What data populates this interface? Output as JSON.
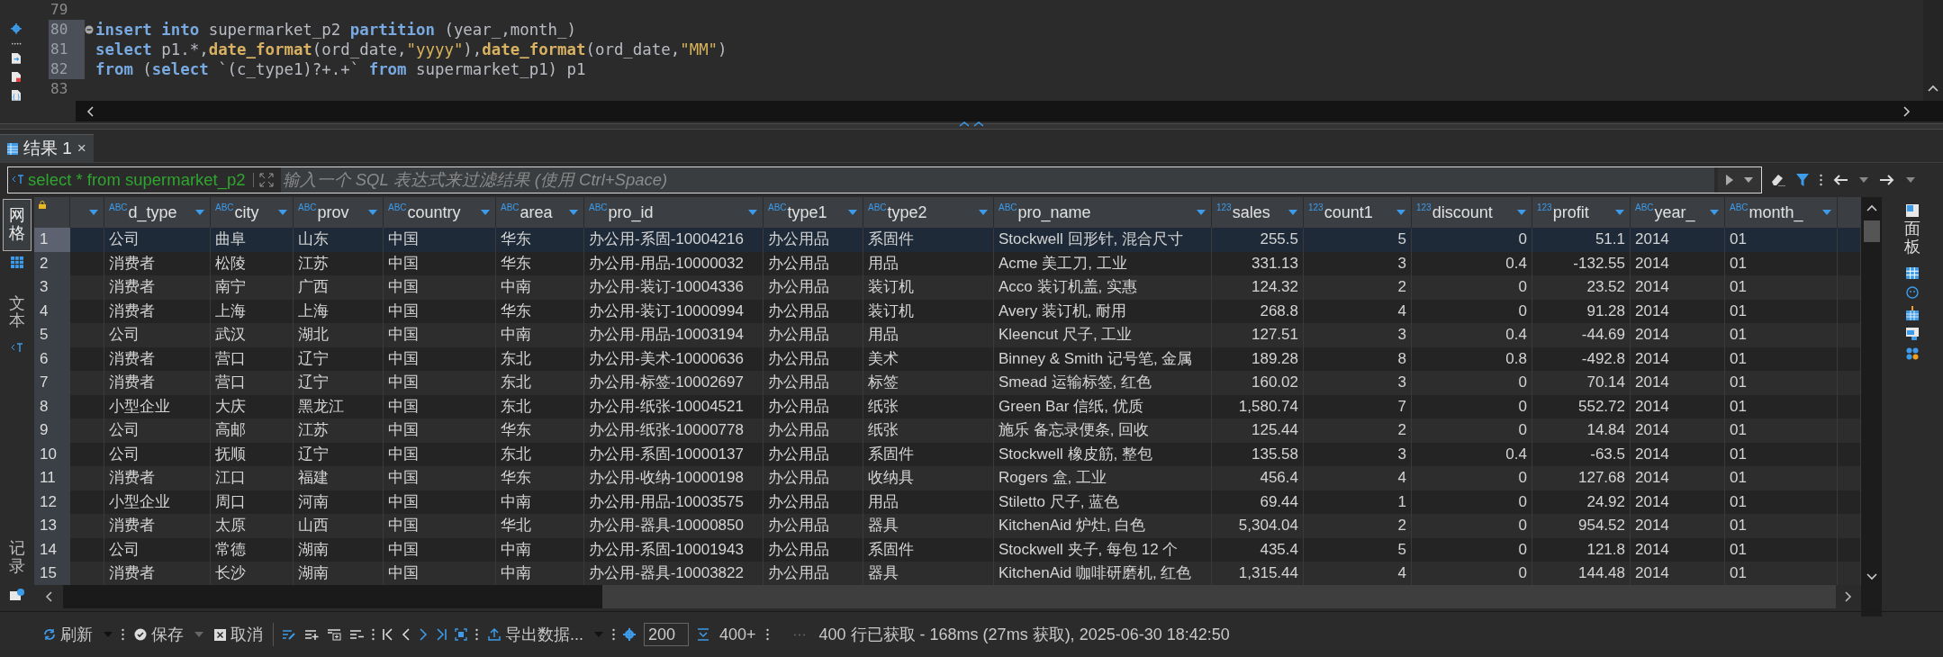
{
  "editor": {
    "lines": [
      {
        "number": "79",
        "selected": false,
        "fold_marker": false
      },
      {
        "number": "80",
        "selected": true,
        "fold_marker": true,
        "tokens": [
          {
            "text": "insert",
            "kind": "keyword"
          },
          {
            "text": " into",
            "kind": "keyword"
          },
          {
            "text": " supermarket_p2 ",
            "kind": "plain"
          },
          {
            "text": "partition",
            "kind": "keyword"
          },
          {
            "text": " (year_,month_)",
            "kind": "plain"
          }
        ]
      },
      {
        "number": "81",
        "selected": true,
        "fold_marker": false,
        "tokens": [
          {
            "text": "select",
            "kind": "keyword"
          },
          {
            "text": " p1.*,",
            "kind": "plain"
          },
          {
            "text": "date_format",
            "kind": "function"
          },
          {
            "text": "(ord_date,",
            "kind": "plain"
          },
          {
            "text": "\"yyyy\"",
            "kind": "string"
          },
          {
            "text": "),",
            "kind": "plain"
          },
          {
            "text": "date_format",
            "kind": "function"
          },
          {
            "text": "(ord_date,",
            "kind": "plain"
          },
          {
            "text": "\"MM\"",
            "kind": "string"
          },
          {
            "text": ")",
            "kind": "plain"
          }
        ]
      },
      {
        "number": "82",
        "selected": true,
        "fold_marker": false,
        "tokens": [
          {
            "text": "from",
            "kind": "keyword"
          },
          {
            "text": " (",
            "kind": "plain"
          },
          {
            "text": "select",
            "kind": "keyword"
          },
          {
            "text": " `(c_type1)?+.+` ",
            "kind": "plain"
          },
          {
            "text": "from",
            "kind": "keyword"
          },
          {
            "text": " supermarket_p1) p1",
            "kind": "plain"
          }
        ]
      },
      {
        "number": "83",
        "selected": false,
        "fold_marker": false
      }
    ]
  },
  "result_tabs": [
    {
      "label": "结果 1",
      "close": "×",
      "selected": true
    }
  ],
  "filter": {
    "query": "select * from supermarket_p2",
    "placeholder": "输入一个 SQL 表达式来过滤结果 (使用 Ctrl+Space)"
  },
  "view_tabs": [
    {
      "label": "网格",
      "selected": true
    },
    {
      "label": "文本",
      "selected": false
    },
    {
      "label": "记录",
      "selected": false
    }
  ],
  "side_panel": {
    "label": "面板"
  },
  "table": {
    "columns": [
      {
        "name": "d_type",
        "type_label": "ABC",
        "kind": "text"
      },
      {
        "name": "city",
        "type_label": "ABC",
        "kind": "text"
      },
      {
        "name": "prov",
        "type_label": "ABC",
        "kind": "text"
      },
      {
        "name": "country",
        "type_label": "ABC",
        "kind": "text"
      },
      {
        "name": "area",
        "type_label": "ABC",
        "kind": "text"
      },
      {
        "name": "pro_id",
        "type_label": "ABC",
        "kind": "text"
      },
      {
        "name": "type1",
        "type_label": "ABC",
        "kind": "text"
      },
      {
        "name": "type2",
        "type_label": "ABC",
        "kind": "text"
      },
      {
        "name": "pro_name",
        "type_label": "ABC",
        "kind": "text"
      },
      {
        "name": "sales",
        "type_label": "123",
        "kind": "number"
      },
      {
        "name": "count1",
        "type_label": "123",
        "kind": "number"
      },
      {
        "name": "discount",
        "type_label": "123",
        "kind": "number"
      },
      {
        "name": "profit",
        "type_label": "123",
        "kind": "number"
      },
      {
        "name": "year_",
        "type_label": "ABC",
        "kind": "text"
      },
      {
        "name": "month_",
        "type_label": "ABC",
        "kind": "text"
      }
    ],
    "rows": [
      {
        "number": "1",
        "selected": true,
        "cells": [
          "公司",
          "曲阜",
          "山东",
          "中国",
          "华东",
          "办公用-系固-10004216",
          "办公用品",
          "系固件",
          "Stockwell 回形针, 混合尺寸",
          "255.5",
          "5",
          "0",
          "51.1",
          "2014",
          "01"
        ]
      },
      {
        "number": "2",
        "selected": false,
        "cells": [
          "消费者",
          "松陵",
          "江苏",
          "中国",
          "华东",
          "办公用-用品-10000032",
          "办公用品",
          "用品",
          "Acme 美工刀, 工业",
          "331.13",
          "3",
          "0.4",
          "-132.55",
          "2014",
          "01"
        ]
      },
      {
        "number": "3",
        "selected": false,
        "cells": [
          "消费者",
          "南宁",
          "广西",
          "中国",
          "中南",
          "办公用-装订-10004336",
          "办公用品",
          "装订机",
          "Acco 装订机盖, 实惠",
          "124.32",
          "2",
          "0",
          "23.52",
          "2014",
          "01"
        ]
      },
      {
        "number": "4",
        "selected": false,
        "cells": [
          "消费者",
          "上海",
          "上海",
          "中国",
          "华东",
          "办公用-装订-10000994",
          "办公用品",
          "装订机",
          "Avery 装订机, 耐用",
          "268.8",
          "4",
          "0",
          "91.28",
          "2014",
          "01"
        ]
      },
      {
        "number": "5",
        "selected": false,
        "cells": [
          "公司",
          "武汉",
          "湖北",
          "中国",
          "中南",
          "办公用-用品-10003194",
          "办公用品",
          "用品",
          "Kleencut 尺子, 工业",
          "127.51",
          "3",
          "0.4",
          "-44.69",
          "2014",
          "01"
        ]
      },
      {
        "number": "6",
        "selected": false,
        "cells": [
          "消费者",
          "营口",
          "辽宁",
          "中国",
          "东北",
          "办公用-美术-10000636",
          "办公用品",
          "美术",
          "Binney & Smith 记号笔, 金属",
          "189.28",
          "8",
          "0.8",
          "-492.8",
          "2014",
          "01"
        ]
      },
      {
        "number": "7",
        "selected": false,
        "cells": [
          "消费者",
          "营口",
          "辽宁",
          "中国",
          "东北",
          "办公用-标签-10002697",
          "办公用品",
          "标签",
          "Smead 运输标签, 红色",
          "160.02",
          "3",
          "0",
          "70.14",
          "2014",
          "01"
        ]
      },
      {
        "number": "8",
        "selected": false,
        "cells": [
          "小型企业",
          "大庆",
          "黑龙江",
          "中国",
          "东北",
          "办公用-纸张-10004521",
          "办公用品",
          "纸张",
          "Green Bar 信纸, 优质",
          "1,580.74",
          "7",
          "0",
          "552.72",
          "2014",
          "01"
        ]
      },
      {
        "number": "9",
        "selected": false,
        "cells": [
          "公司",
          "高邮",
          "江苏",
          "中国",
          "华东",
          "办公用-纸张-10000778",
          "办公用品",
          "纸张",
          "施乐 备忘录便条, 回收",
          "125.44",
          "2",
          "0",
          "14.84",
          "2014",
          "01"
        ]
      },
      {
        "number": "10",
        "selected": false,
        "cells": [
          "公司",
          "抚顺",
          "辽宁",
          "中国",
          "东北",
          "办公用-系固-10000137",
          "办公用品",
          "系固件",
          "Stockwell 橡皮筋, 整包",
          "135.58",
          "3",
          "0.4",
          "-63.5",
          "2014",
          "01"
        ]
      },
      {
        "number": "11",
        "selected": false,
        "cells": [
          "消费者",
          "江口",
          "福建",
          "中国",
          "华东",
          "办公用-收纳-10000198",
          "办公用品",
          "收纳具",
          "Rogers 盒, 工业",
          "456.4",
          "4",
          "0",
          "127.68",
          "2014",
          "01"
        ]
      },
      {
        "number": "12",
        "selected": false,
        "cells": [
          "小型企业",
          "周口",
          "河南",
          "中国",
          "中南",
          "办公用-用品-10003575",
          "办公用品",
          "用品",
          "Stiletto 尺子, 蓝色",
          "69.44",
          "1",
          "0",
          "24.92",
          "2014",
          "01"
        ]
      },
      {
        "number": "13",
        "selected": false,
        "cells": [
          "消费者",
          "太原",
          "山西",
          "中国",
          "华北",
          "办公用-器具-10000850",
          "办公用品",
          "器具",
          "KitchenAid 炉灶, 白色",
          "5,304.04",
          "2",
          "0",
          "954.52",
          "2014",
          "01"
        ]
      },
      {
        "number": "14",
        "selected": false,
        "cells": [
          "公司",
          "常德",
          "湖南",
          "中国",
          "中南",
          "办公用-系固-10001943",
          "办公用品",
          "系固件",
          "Stockwell 夹子, 每包 12 个",
          "435.4",
          "5",
          "0",
          "121.8",
          "2014",
          "01"
        ]
      },
      {
        "number": "15",
        "selected": false,
        "cells": [
          "消费者",
          "长沙",
          "湖南",
          "中国",
          "中南",
          "办公用-器具-10003822",
          "办公用品",
          "器具",
          "KitchenAid 咖啡研磨机, 红色",
          "1,315.44",
          "4",
          "0",
          "144.48",
          "2014",
          "01"
        ]
      }
    ]
  },
  "toolbar": {
    "refresh": "刷新",
    "save": "保存",
    "cancel": "取消",
    "export": "导出数据...",
    "fetch_size": "200",
    "fetch_more": "400+",
    "status": "400 行已获取 - 168ms (27ms 获取), 2025-06-30 18:42:50"
  }
}
